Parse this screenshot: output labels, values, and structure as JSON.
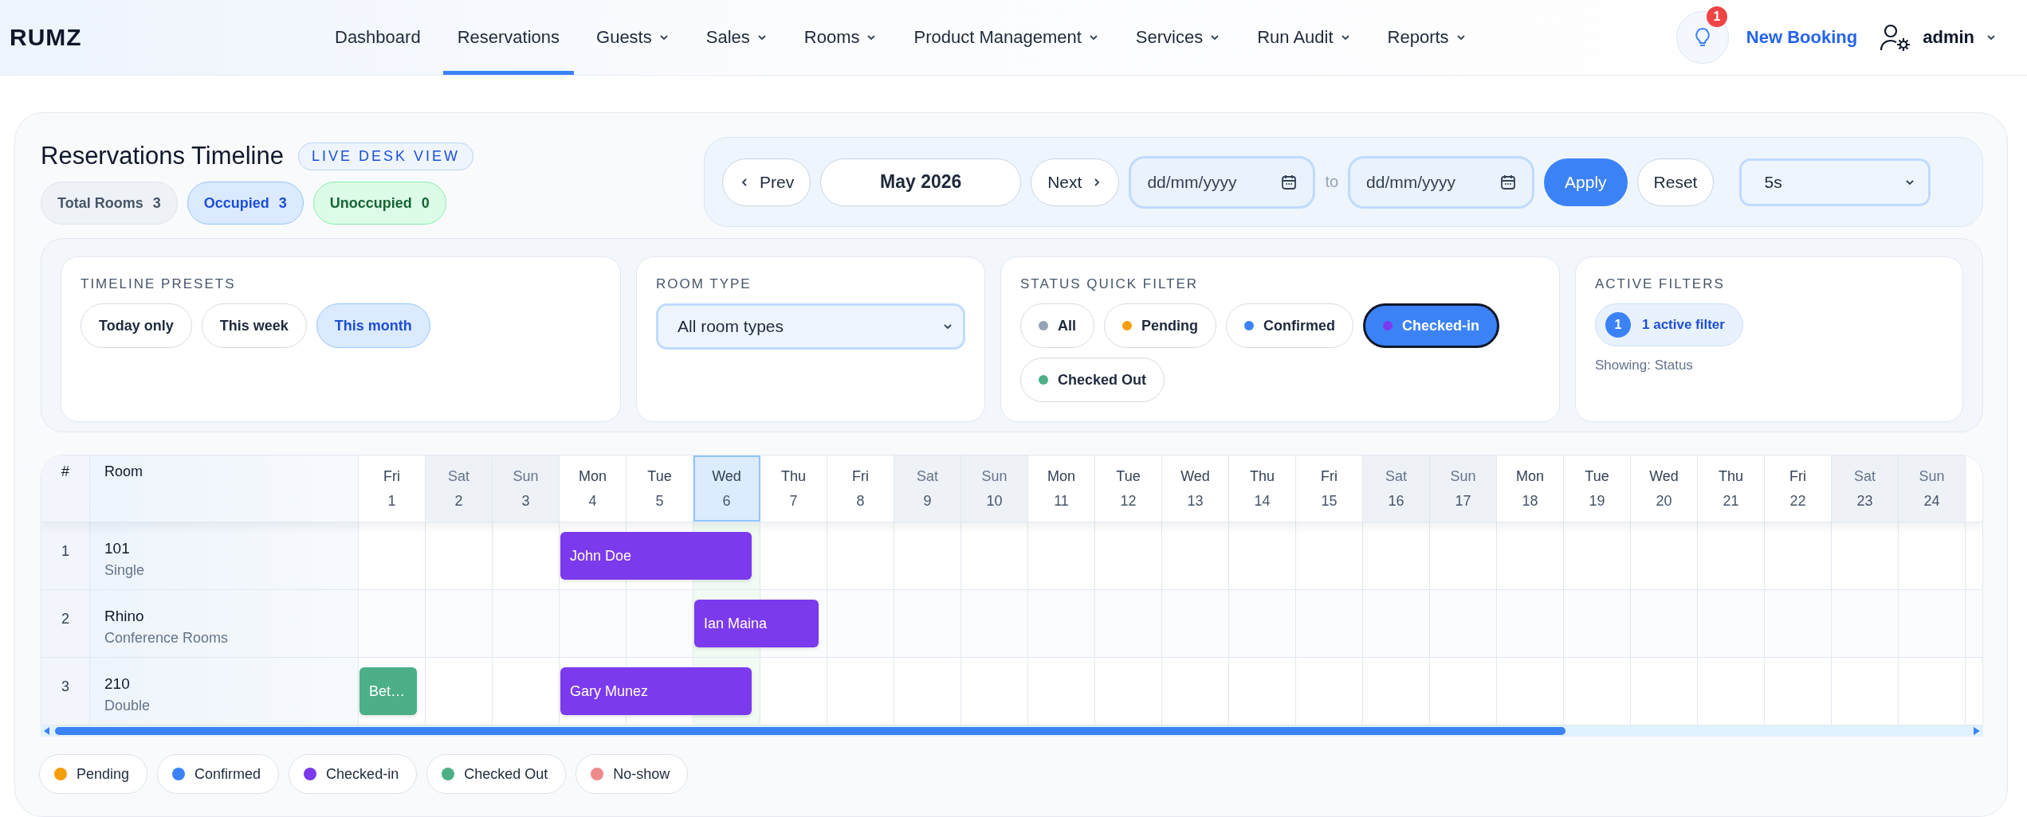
{
  "brand": "RUMZ",
  "nav": [
    {
      "label": "Dashboard",
      "dropdown": false,
      "selected": false
    },
    {
      "label": "Reservations",
      "dropdown": false,
      "selected": true
    },
    {
      "label": "Guests",
      "dropdown": true,
      "selected": false
    },
    {
      "label": "Sales",
      "dropdown": true,
      "selected": false
    },
    {
      "label": "Rooms",
      "dropdown": true,
      "selected": false
    },
    {
      "label": "Product Management",
      "dropdown": true,
      "selected": false
    },
    {
      "label": "Services",
      "dropdown": true,
      "selected": false
    },
    {
      "label": "Run Audit",
      "dropdown": true,
      "selected": false
    },
    {
      "label": "Reports",
      "dropdown": true,
      "selected": false
    }
  ],
  "notifications": {
    "count": "1"
  },
  "new_booking": "New Booking",
  "user": {
    "name": "admin"
  },
  "header": {
    "title": "Reservations Timeline",
    "badge": "LIVE DESK VIEW",
    "stats": [
      {
        "kind": "neutral",
        "label": "Total Rooms",
        "value": "3"
      },
      {
        "kind": "occupied",
        "label": "Occupied",
        "value": "3"
      },
      {
        "kind": "unoccupied",
        "label": "Unoccupied",
        "value": "0"
      }
    ]
  },
  "toolbar": {
    "prev": "Prev",
    "month": "May 2026",
    "next": "Next",
    "from": {
      "placeholder": "dd/mm/yyyy"
    },
    "to_label": "to",
    "to": {
      "placeholder": "dd/mm/yyyy"
    },
    "apply": "Apply",
    "reset": "Reset",
    "refresh": "5s"
  },
  "presets": {
    "title": "TIMELINE PRESETS",
    "items": [
      {
        "label": "Today only",
        "selected": false
      },
      {
        "label": "This week",
        "selected": false
      },
      {
        "label": "This month",
        "selected": true
      }
    ]
  },
  "room_type": {
    "title": "ROOM TYPE",
    "value": "All room types"
  },
  "status_filter": {
    "title": "STATUS QUICK FILTER",
    "items": [
      {
        "label": "All",
        "color": "#94a3b8",
        "selected": false
      },
      {
        "label": "Pending",
        "color": "#f59e0b",
        "selected": false
      },
      {
        "label": "Confirmed",
        "color": "#3b82f6",
        "selected": false
      },
      {
        "label": "Checked-in",
        "color": "#7c3aed",
        "selected": true
      },
      {
        "label": "Checked Out",
        "color": "#4caf87",
        "selected": false
      }
    ]
  },
  "active_filters": {
    "title": "ACTIVE FILTERS",
    "count": "1",
    "label": "1 active filter",
    "showing": "Showing: Status"
  },
  "timeline": {
    "columns": {
      "number": "#",
      "room": "Room"
    },
    "days": [
      {
        "weekday": "Fri",
        "day": "1",
        "weekend": false,
        "today": false
      },
      {
        "weekday": "Sat",
        "day": "2",
        "weekend": true,
        "today": false
      },
      {
        "weekday": "Sun",
        "day": "3",
        "weekend": true,
        "today": false
      },
      {
        "weekday": "Mon",
        "day": "4",
        "weekend": false,
        "today": false
      },
      {
        "weekday": "Tue",
        "day": "5",
        "weekend": false,
        "today": false
      },
      {
        "weekday": "Wed",
        "day": "6",
        "weekend": false,
        "today": true
      },
      {
        "weekday": "Thu",
        "day": "7",
        "weekend": false,
        "today": false
      },
      {
        "weekday": "Fri",
        "day": "8",
        "weekend": false,
        "today": false
      },
      {
        "weekday": "Sat",
        "day": "9",
        "weekend": true,
        "today": false
      },
      {
        "weekday": "Sun",
        "day": "10",
        "weekend": true,
        "today": false
      },
      {
        "weekday": "Mon",
        "day": "11",
        "weekend": false,
        "today": false
      },
      {
        "weekday": "Tue",
        "day": "12",
        "weekend": false,
        "today": false
      },
      {
        "weekday": "Wed",
        "day": "13",
        "weekend": false,
        "today": false
      },
      {
        "weekday": "Thu",
        "day": "14",
        "weekend": false,
        "today": false
      },
      {
        "weekday": "Fri",
        "day": "15",
        "weekend": false,
        "today": false
      },
      {
        "weekday": "Sat",
        "day": "16",
        "weekend": true,
        "today": false
      },
      {
        "weekday": "Sun",
        "day": "17",
        "weekend": true,
        "today": false
      },
      {
        "weekday": "Mon",
        "day": "18",
        "weekend": false,
        "today": false
      },
      {
        "weekday": "Tue",
        "day": "19",
        "weekend": false,
        "today": false
      },
      {
        "weekday": "Wed",
        "day": "20",
        "weekend": false,
        "today": false
      },
      {
        "weekday": "Thu",
        "day": "21",
        "weekend": false,
        "today": false
      },
      {
        "weekday": "Fri",
        "day": "22",
        "weekend": false,
        "today": false
      },
      {
        "weekday": "Sat",
        "day": "23",
        "weekend": true,
        "today": false
      },
      {
        "weekday": "Sun",
        "day": "24",
        "weekend": true,
        "today": false
      }
    ],
    "rows": [
      {
        "number": "1",
        "room": "101",
        "type": "Single",
        "slots": [
          {
            "kind": "empty"
          },
          {
            "kind": "empty"
          },
          {
            "kind": "empty"
          },
          {
            "kind": "booking",
            "guest": "John Doe",
            "color": "#7c3aed"
          },
          {
            "kind": "continue"
          },
          {
            "kind": "continue"
          },
          {
            "kind": "empty"
          },
          {
            "kind": "empty"
          },
          {
            "kind": "empty"
          },
          {
            "kind": "empty"
          },
          {
            "kind": "empty"
          },
          {
            "kind": "empty"
          },
          {
            "kind": "empty"
          },
          {
            "kind": "empty"
          },
          {
            "kind": "empty"
          },
          {
            "kind": "empty"
          },
          {
            "kind": "empty"
          },
          {
            "kind": "empty"
          },
          {
            "kind": "empty"
          },
          {
            "kind": "empty"
          },
          {
            "kind": "empty"
          },
          {
            "kind": "empty"
          },
          {
            "kind": "empty"
          },
          {
            "kind": "empty"
          }
        ]
      },
      {
        "number": "2",
        "room": "Rhino",
        "type": "Conference Rooms",
        "slots": [
          {
            "kind": "empty"
          },
          {
            "kind": "empty"
          },
          {
            "kind": "empty"
          },
          {
            "kind": "empty"
          },
          {
            "kind": "empty"
          },
          {
            "kind": "booking",
            "guest": "Ian Maina",
            "color": "#7c3aed"
          },
          {
            "kind": "continue"
          },
          {
            "kind": "empty"
          },
          {
            "kind": "empty"
          },
          {
            "kind": "empty"
          },
          {
            "kind": "empty"
          },
          {
            "kind": "empty"
          },
          {
            "kind": "empty"
          },
          {
            "kind": "empty"
          },
          {
            "kind": "empty"
          },
          {
            "kind": "empty"
          },
          {
            "kind": "empty"
          },
          {
            "kind": "empty"
          },
          {
            "kind": "empty"
          },
          {
            "kind": "empty"
          },
          {
            "kind": "empty"
          },
          {
            "kind": "empty"
          },
          {
            "kind": "empty"
          },
          {
            "kind": "empty"
          }
        ]
      },
      {
        "number": "3",
        "room": "210",
        "type": "Double",
        "slots": [
          {
            "kind": "booking",
            "guest": "Bet…",
            "color": "#4caf87"
          },
          {
            "kind": "empty"
          },
          {
            "kind": "empty"
          },
          {
            "kind": "booking",
            "guest": "Gary Munez",
            "color": "#7c3aed"
          },
          {
            "kind": "continue"
          },
          {
            "kind": "continue"
          },
          {
            "kind": "empty"
          },
          {
            "kind": "empty"
          },
          {
            "kind": "empty"
          },
          {
            "kind": "empty"
          },
          {
            "kind": "empty"
          },
          {
            "kind": "empty"
          },
          {
            "kind": "empty"
          },
          {
            "kind": "empty"
          },
          {
            "kind": "empty"
          },
          {
            "kind": "empty"
          },
          {
            "kind": "empty"
          },
          {
            "kind": "empty"
          },
          {
            "kind": "empty"
          },
          {
            "kind": "empty"
          },
          {
            "kind": "empty"
          },
          {
            "kind": "empty"
          },
          {
            "kind": "empty"
          },
          {
            "kind": "empty"
          }
        ]
      }
    ]
  },
  "legend": [
    {
      "label": "Pending",
      "color": "#f59e0b"
    },
    {
      "label": "Confirmed",
      "color": "#3b82f6"
    },
    {
      "label": "Checked-in",
      "color": "#7c3aed"
    },
    {
      "label": "Checked Out",
      "color": "#4caf87"
    },
    {
      "label": "No-show",
      "color": "#ef8a8a"
    }
  ]
}
